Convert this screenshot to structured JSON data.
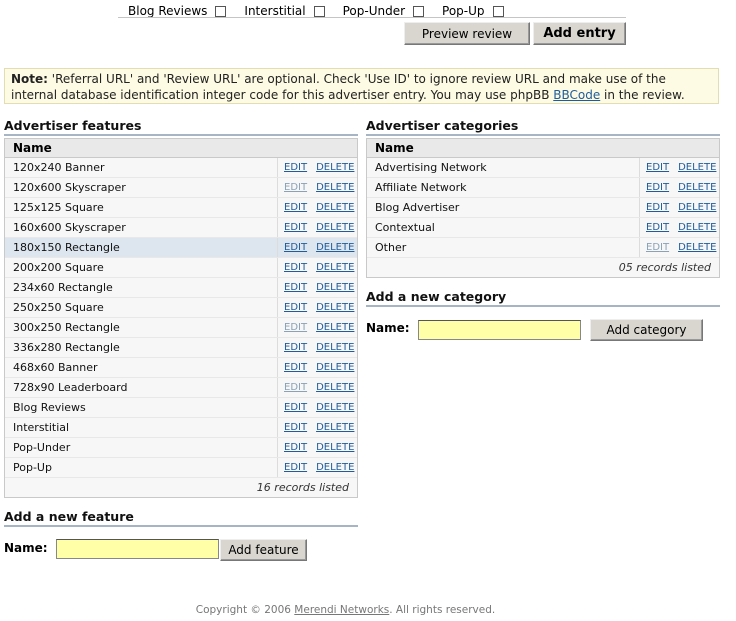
{
  "top_options": [
    {
      "label": "Blog Reviews",
      "checked": false
    },
    {
      "label": "Interstitial",
      "checked": false
    },
    {
      "label": "Pop-Under",
      "checked": false
    },
    {
      "label": "Pop-Up",
      "checked": false
    }
  ],
  "buttons": {
    "preview": "Preview review",
    "add_entry": "Add entry"
  },
  "note": {
    "label": "Note:",
    "text_before": " 'Referral URL' and 'Review URL' are optional. Check 'Use ID' to ignore review URL and make use of the internal database identification integer code for this advertiser entry. You may use phpBB ",
    "link": "BBCode",
    "text_after": " in the review."
  },
  "features": {
    "title": "Advertiser features",
    "header": "Name",
    "edit": "EDIT",
    "delete": "DELETE",
    "rows": [
      "120x240 Banner",
      "120x600 Skyscraper",
      "125x125 Square",
      "160x600 Skyscraper",
      "180x150 Rectangle",
      "200x200 Square",
      "234x60 Rectangle",
      "250x250 Square",
      "300x250 Rectangle",
      "336x280 Rectangle",
      "468x60 Banner",
      "728x90 Leaderboard",
      "Blog Reviews",
      "Interstitial",
      "Pop-Under",
      "Pop-Up"
    ],
    "footer": "16 records listed",
    "add_title": "Add a new feature",
    "add_label": "Name:",
    "add_button": "Add feature",
    "input_value": ""
  },
  "categories": {
    "title": "Advertiser categories",
    "header": "Name",
    "edit": "EDIT",
    "delete": "DELETE",
    "rows": [
      "Advertising Network",
      "Affiliate Network",
      "Blog Advertiser",
      "Contextual",
      "Other"
    ],
    "footer": "05 records listed",
    "add_title": "Add a new category",
    "add_label": "Name:",
    "add_button": "Add category",
    "input_value": ""
  },
  "footer": {
    "before": "Copyright © 2006 ",
    "link": "Merendi Networks",
    "after": ". All rights reserved."
  }
}
